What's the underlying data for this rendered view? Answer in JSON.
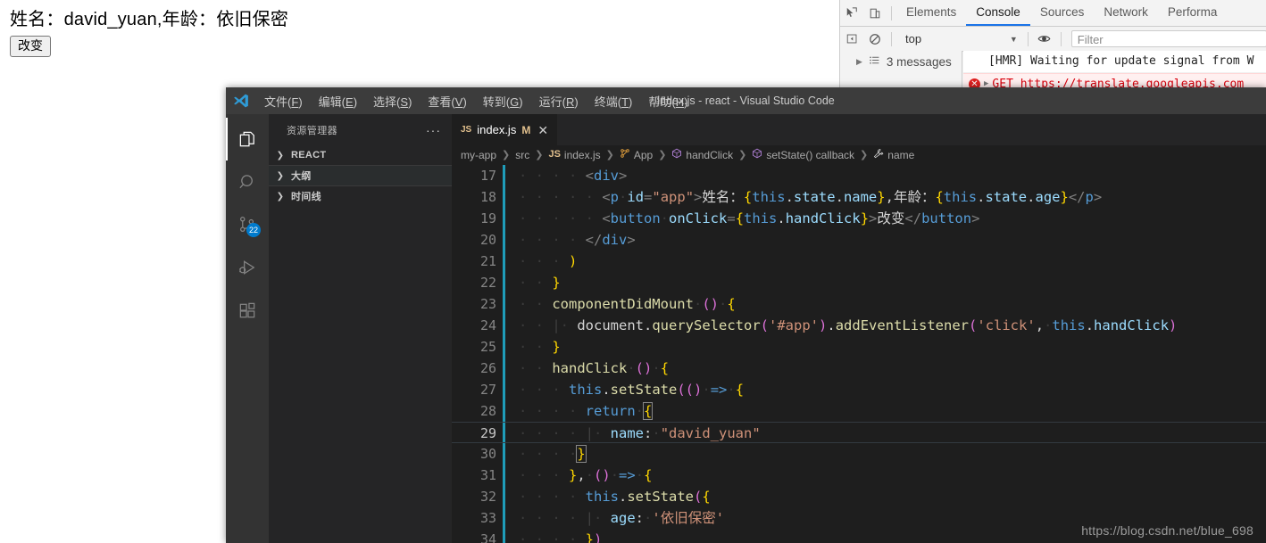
{
  "page": {
    "text": "姓名：david_yuan,年龄：依旧保密",
    "button_label": "改变"
  },
  "devtools": {
    "icons": {
      "inspect": "inspect-element-icon",
      "device": "device-toolbar-icon",
      "back": "console-sidebar-toggle-icon",
      "clear": "clear-console-icon",
      "eye": "live-expression-icon",
      "list": "message-list-icon"
    },
    "tabs": [
      {
        "label": "Elements",
        "active": false
      },
      {
        "label": "Console",
        "active": true
      },
      {
        "label": "Sources",
        "active": false
      },
      {
        "label": "Network",
        "active": false
      },
      {
        "label": "Performa",
        "active": false
      }
    ],
    "context_selector": "top",
    "filter_placeholder": "Filter",
    "sidebar": {
      "messages_label": "3 messages"
    },
    "console_lines": [
      {
        "type": "log",
        "text": "[HMR] Waiting for update signal from W"
      },
      {
        "type": "error",
        "text": "GET https://translate.googleapis.com"
      }
    ],
    "accent_color": "#1a73e8",
    "error_color": "#d8000c"
  },
  "vscode": {
    "window_title": "index.js - react - Visual Studio Code",
    "menu": [
      {
        "label": "文件",
        "accel": "F"
      },
      {
        "label": "编辑",
        "accel": "E"
      },
      {
        "label": "选择",
        "accel": "S"
      },
      {
        "label": "查看",
        "accel": "V"
      },
      {
        "label": "转到",
        "accel": "G"
      },
      {
        "label": "运行",
        "accel": "R"
      },
      {
        "label": "终端",
        "accel": "T"
      },
      {
        "label": "帮助",
        "accel": "H"
      }
    ],
    "activity_bar": [
      {
        "name": "explorer-icon",
        "active": true,
        "badge": null
      },
      {
        "name": "search-icon",
        "active": false,
        "badge": null
      },
      {
        "name": "source-control-icon",
        "active": false,
        "badge": "22"
      },
      {
        "name": "run-and-debug-icon",
        "active": false,
        "badge": null
      },
      {
        "name": "extensions-icon",
        "active": false,
        "badge": null
      }
    ],
    "sidebar": {
      "title": "资源管理器",
      "more_actions": "···",
      "sections": [
        {
          "label": "REACT",
          "expanded": false,
          "highlighted": false
        },
        {
          "label": "大纲",
          "expanded": false,
          "highlighted": true
        },
        {
          "label": "时间线",
          "expanded": false,
          "highlighted": false
        }
      ]
    },
    "tab": {
      "file_icon": "JS",
      "filename": "index.js",
      "dirty_marker": "M",
      "close_label": "✕"
    },
    "breadcrumb": [
      {
        "label": "my-app",
        "icon": null
      },
      {
        "label": "src",
        "icon": null
      },
      {
        "label": "index.js",
        "icon": "js-file-icon"
      },
      {
        "label": "App",
        "icon": "class-icon"
      },
      {
        "label": "handClick",
        "icon": "method-icon"
      },
      {
        "label": "setState() callback",
        "icon": "method-icon"
      },
      {
        "label": "name",
        "icon": "property-icon"
      }
    ],
    "editor": {
      "first_line_number": 17,
      "current_line": 29,
      "lines": [
        {
          "n": 17,
          "indent": 4,
          "guides": 2,
          "text": "<div>"
        },
        {
          "n": 18,
          "indent": 5,
          "guides": 3,
          "text": "<p id=\"app\">姓名：{this.state.name},年龄：{this.state.age}</p>"
        },
        {
          "n": 19,
          "indent": 5,
          "guides": 3,
          "text": "<button onClick={this.handClick}>改变</button>"
        },
        {
          "n": 20,
          "indent": 4,
          "guides": 2,
          "text": "</div>"
        },
        {
          "n": 21,
          "indent": 3,
          "guides": 0,
          "text": ")"
        },
        {
          "n": 22,
          "indent": 2,
          "guides": 0,
          "text": "}"
        },
        {
          "n": 23,
          "indent": 2,
          "guides": 0,
          "text": "componentDidMount () {"
        },
        {
          "n": 24,
          "indent": 3,
          "guides": 1,
          "text": "document.querySelector('#app').addEventListener('click', this.handClick)"
        },
        {
          "n": 25,
          "indent": 2,
          "guides": 0,
          "text": "}"
        },
        {
          "n": 26,
          "indent": 2,
          "guides": 0,
          "text": "handClick () {"
        },
        {
          "n": 27,
          "indent": 3,
          "guides": 1,
          "text": "this.setState(() => {"
        },
        {
          "n": 28,
          "indent": 4,
          "guides": 2,
          "text": "return {"
        },
        {
          "n": 29,
          "indent": 5,
          "guides": 3,
          "text": "name: \"david_yuan\""
        },
        {
          "n": 30,
          "indent": 4,
          "guides": 2,
          "text": "}"
        },
        {
          "n": 31,
          "indent": 3,
          "guides": 1,
          "text": "}, () => {"
        },
        {
          "n": 32,
          "indent": 4,
          "guides": 2,
          "text": "this.setState({"
        },
        {
          "n": 33,
          "indent": 5,
          "guides": 3,
          "text": "age: '依旧保密'"
        },
        {
          "n": 34,
          "indent": 4,
          "guides": 2,
          "text": "})"
        }
      ]
    }
  },
  "watermark": "https://blog.csdn.net/blue_698"
}
